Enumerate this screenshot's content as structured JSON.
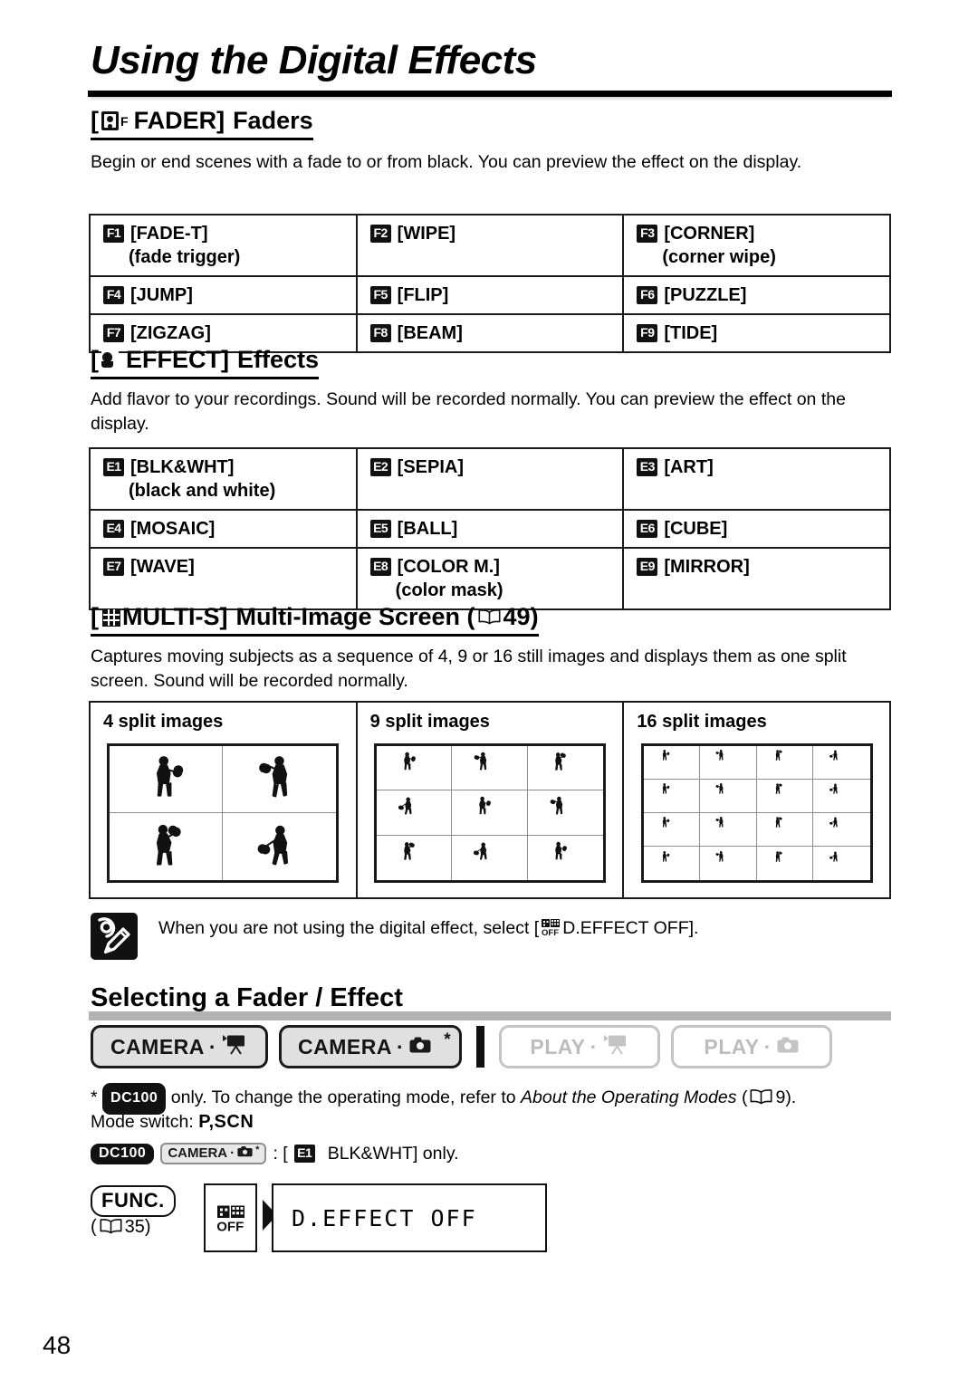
{
  "page": {
    "title": "Using the Digital Effects",
    "number": "48"
  },
  "fader_section": {
    "bracket_open": "[",
    "icon": "fader-icon",
    "icon_subscript": "F",
    "label": "FADER]",
    "heading_suffix": "Faders",
    "body": "Begin or end scenes with a fade to or from black. You can preview the effect on the display.",
    "table": [
      [
        {
          "badge": "F1",
          "label": "[FADE-T]",
          "sub": "(fade trigger)"
        },
        {
          "badge": "F2",
          "label": "[WIPE]",
          "sub": ""
        },
        {
          "badge": "F3",
          "label": "[CORNER]",
          "sub": "(corner wipe)"
        }
      ],
      [
        {
          "badge": "F4",
          "label": "[JUMP]",
          "sub": ""
        },
        {
          "badge": "F5",
          "label": "[FLIP]",
          "sub": ""
        },
        {
          "badge": "F6",
          "label": "[PUZZLE]",
          "sub": ""
        }
      ],
      [
        {
          "badge": "F7",
          "label": "[ZIGZAG]",
          "sub": ""
        },
        {
          "badge": "F8",
          "label": "[BEAM]",
          "sub": ""
        },
        {
          "badge": "F9",
          "label": "[TIDE]",
          "sub": ""
        }
      ]
    ]
  },
  "effect_section": {
    "bracket_open": "[",
    "icon": "effect-icon",
    "label": "EFFECT]",
    "heading_suffix": "Effects",
    "body": "Add flavor to your recordings. Sound will be recorded normally. You can preview the effect on the display.",
    "table": [
      [
        {
          "badge": "E1",
          "label": "[BLK&WHT]",
          "sub": "(black and white)"
        },
        {
          "badge": "E2",
          "label": "[SEPIA]",
          "sub": ""
        },
        {
          "badge": "E3",
          "label": "[ART]",
          "sub": ""
        }
      ],
      [
        {
          "badge": "E4",
          "label": "[MOSAIC]",
          "sub": ""
        },
        {
          "badge": "E5",
          "label": "[BALL]",
          "sub": ""
        },
        {
          "badge": "E6",
          "label": "[CUBE]",
          "sub": ""
        }
      ],
      [
        {
          "badge": "E7",
          "label": "[WAVE]",
          "sub": ""
        },
        {
          "badge": "E8",
          "label": "[COLOR M.]",
          "sub": "(color mask)"
        },
        {
          "badge": "E9",
          "label": "[MIRROR]",
          "sub": ""
        }
      ]
    ]
  },
  "multis_section": {
    "bracket_open": "[",
    "icon": "multi-screen-icon",
    "label": "MULTI-S]",
    "heading_suffix": "Multi-Image Screen (",
    "page_ref": "49",
    "heading_close": ")",
    "body": "Captures moving subjects as a sequence of 4, 9 or 16 still images and displays them as one split screen. Sound will be recorded normally.",
    "splits": [
      {
        "label": "4 split images",
        "cols": 2,
        "rows": 2
      },
      {
        "label": "9 split images",
        "cols": 3,
        "rows": 3
      },
      {
        "label": "16 split images",
        "cols": 4,
        "rows": 4
      }
    ]
  },
  "note": {
    "icon": "notes-pencil-icon",
    "text_before": "When you are not using the digital effect, select [",
    "icon_inline": "d-effect-off-icon",
    "text_after": "D.EFFECT OFF]."
  },
  "selecting": {
    "title": "Selecting a Fader / Effect",
    "modes": [
      {
        "label": "CAMERA",
        "sep": "·",
        "icon": "movie-camera-icon",
        "state": "on",
        "star": ""
      },
      {
        "label": "CAMERA",
        "sep": "·",
        "icon": "photo-camera-icon",
        "state": "on",
        "star": "*"
      },
      {
        "label": "PLAY",
        "sep": "·",
        "icon": "movie-camera-icon",
        "state": "off",
        "star": ""
      },
      {
        "label": "PLAY",
        "sep": "·",
        "icon": "photo-camera-icon",
        "state": "off",
        "star": ""
      }
    ],
    "footnote_star": "*",
    "footnote_badge": "DC100",
    "footnote_text_a": "only. To change the operating mode, refer to ",
    "footnote_italic": "About the Operating Modes",
    "footnote_text_b": "(",
    "footnote_page": "9",
    "footnote_text_c": ").",
    "mode_switch_label": "Mode switch:",
    "mode_switch_value": "P,SCN",
    "restriction_badge": "DC100",
    "restriction_mode_label": "CAMERA",
    "restriction_mode_star": "*",
    "restriction_sep": ":  [",
    "restriction_badge2": "E1",
    "restriction_text": "BLK&WHT] only."
  },
  "func_block": {
    "button_label": "FUNC.",
    "ref_open": "(",
    "ref_page": "35",
    "ref_close": ")",
    "step_icon": "d-effect-off-icon",
    "arrow": "double-chevron-right-icon",
    "display_text": "D.EFFECT OFF"
  },
  "colors": {
    "ink": "#111111",
    "rule": "#b3b3b3",
    "mode_on_bg": "#e0e0e0",
    "mode_off_fg": "#bdbdbd"
  }
}
